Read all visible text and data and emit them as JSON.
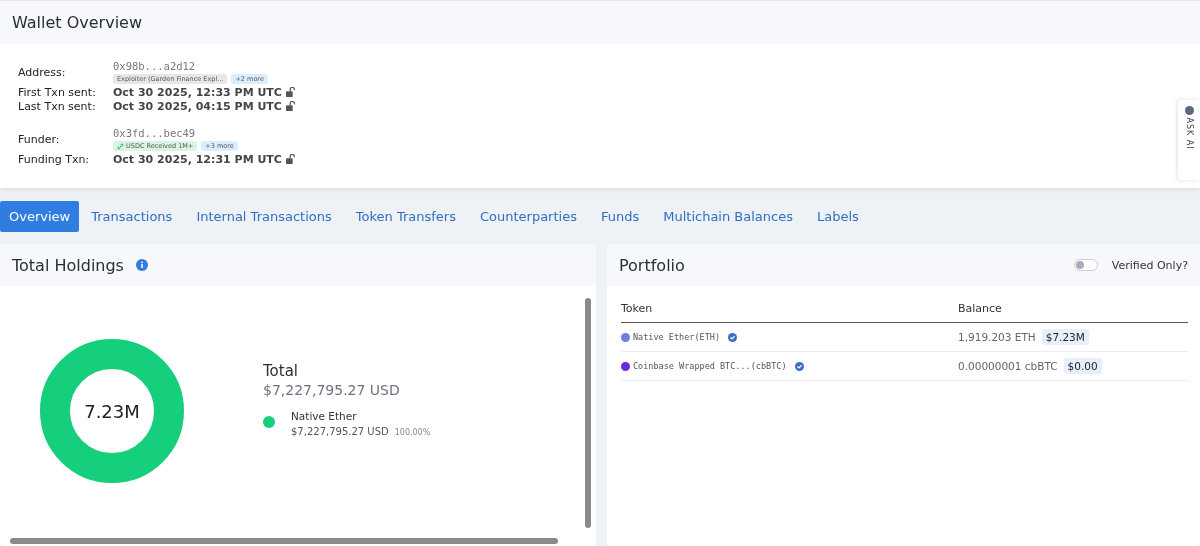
{
  "header": {
    "title": "Wallet Overview"
  },
  "details": [
    {
      "kind": "address",
      "label": "Address:",
      "value": "0x98b...a2d12",
      "tags": [
        {
          "text": "Exploiter (Garden Finance Expl...",
          "color": "#e5e7eb",
          "link": false
        },
        {
          "text": "+2 more",
          "color": "#dbeefe",
          "link": false
        }
      ]
    },
    {
      "kind": "time",
      "label": "First Txn sent:",
      "value": "Oct 30 2025, 12:33 PM UTC"
    },
    {
      "kind": "time",
      "label": "Last Txn sent:",
      "value": "Oct 30 2025, 04:15 PM UTC"
    },
    {
      "kind": "gap"
    },
    {
      "kind": "address",
      "label": "Funder:",
      "value": "0x3fd...bec49",
      "tags": [
        {
          "text": "USDC Received 1M+",
          "color": "#d6f5e3",
          "link": true
        },
        {
          "text": "+3 more",
          "color": "#dbeefe",
          "link": false
        }
      ]
    },
    {
      "kind": "time",
      "label": "Funding Txn:",
      "value": "Oct 30 2025, 12:31 PM UTC"
    }
  ],
  "side_tab": {
    "label": "ASK AI"
  },
  "tabs": [
    {
      "label": "Overview",
      "selected": true
    },
    {
      "label": "Transactions",
      "selected": false
    },
    {
      "label": "Internal Transactions",
      "selected": false
    },
    {
      "label": "Token Transfers",
      "selected": false
    },
    {
      "label": "Counterparties",
      "selected": false
    },
    {
      "label": "Funds",
      "selected": false
    },
    {
      "label": "Multichain Balances",
      "selected": false
    },
    {
      "label": "Labels",
      "selected": false
    }
  ],
  "holdings": {
    "title": "Total Holdings",
    "center_label": "7.23M",
    "total_label": "Total",
    "total_value": "$7,227,795.27 USD",
    "legend": [
      {
        "name": "Native Ether",
        "value": "$7,227,795.27 USD",
        "share": "100.00%",
        "color": "#16cf7c"
      }
    ]
  },
  "portfolio": {
    "title": "Portfolio",
    "toggle": {
      "label": "Verified Only?",
      "on": false
    },
    "columns": [
      "Token",
      "Balance"
    ],
    "rows": [
      {
        "token": "Native Ether(ETH)",
        "color": "#6b7fe0",
        "balance": "1,919.203 ETH",
        "usd": "$7.23M"
      },
      {
        "token": "Coinbase Wrapped BTC...(cbBTC)",
        "color": "#6c2bd9",
        "balance": "0.00000001 cbBTC",
        "usd": "$0.00"
      }
    ]
  }
}
